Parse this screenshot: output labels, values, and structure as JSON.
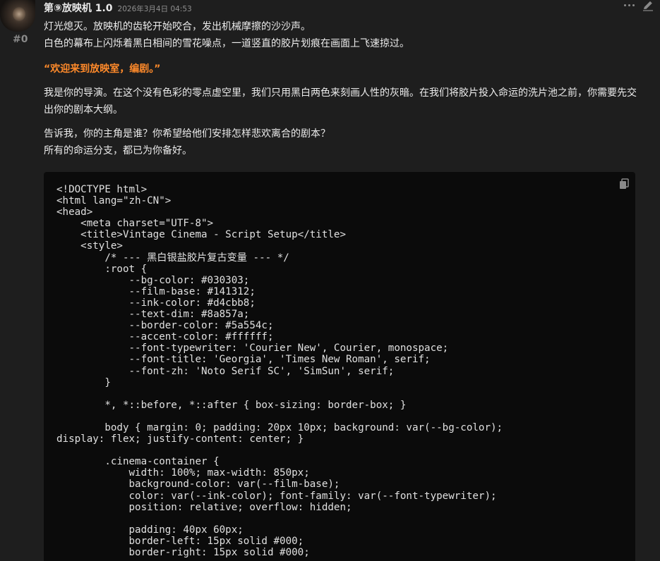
{
  "post": {
    "avatar_icon": "film-projector-avatar-icon",
    "number": "#0",
    "author": "第⑨放映机 1.0",
    "timestamp": "2026年3月4日 04:53",
    "icons": {
      "more": "more-dots-icon",
      "edit": "pencil-icon",
      "copy": "copy-icon"
    },
    "colors": {
      "quote": "#ff8a2a",
      "background": "#1e1e1e",
      "code_background": "#0b0b0b"
    }
  },
  "content": {
    "line1": "灯光熄灭。放映机的齿轮开始咬合，发出机械摩擦的沙沙声。",
    "line2": "白色的幕布上闪烁着黑白相间的雪花噪点，一道竖直的胶片划痕在画面上飞速掠过。",
    "quote": "“欢迎来到放映室，编剧。”",
    "para3": "我是你的导演。在这个没有色彩的零点虚空里，我们只用黑白两色来刻画人性的灰暗。在我们将胶片投入命运的洗片池之前，你需要先交出你的剧本大纲。",
    "line4": "告诉我，你的主角是谁？你希望给他们安排怎样悲欢离合的剧本？",
    "line5": "所有的命运分支，都已为你备好。"
  },
  "code": {
    "language": "html",
    "text": "<!DOCTYPE html>\n<html lang=\"zh-CN\">\n<head>\n    <meta charset=\"UTF-8\">\n    <title>Vintage Cinema - Script Setup</title>\n    <style>\n        /* --- 黑白银盐胶片复古变量 --- */\n        :root {\n            --bg-color: #030303;\n            --film-base: #141312;\n            --ink-color: #d4cbb8;\n            --text-dim: #8a857a;\n            --border-color: #5a554c;\n            --accent-color: #ffffff;\n            --font-typewriter: 'Courier New', Courier, monospace;\n            --font-title: 'Georgia', 'Times New Roman', serif;\n            --font-zh: 'Noto Serif SC', 'SimSun', serif;\n        }\n\n        *, *::before, *::after { box-sizing: border-box; }\n\n        body { margin: 0; padding: 20px 10px; background: var(--bg-color);\ndisplay: flex; justify-content: center; }\n\n        .cinema-container {\n            width: 100%; max-width: 850px;\n            background-color: var(--film-base);\n            color: var(--ink-color); font-family: var(--font-typewriter);\n            position: relative; overflow: hidden;\n\n            padding: 40px 60px;\n            border-left: 15px solid #000;\n            border-right: 15px solid #000;"
  }
}
